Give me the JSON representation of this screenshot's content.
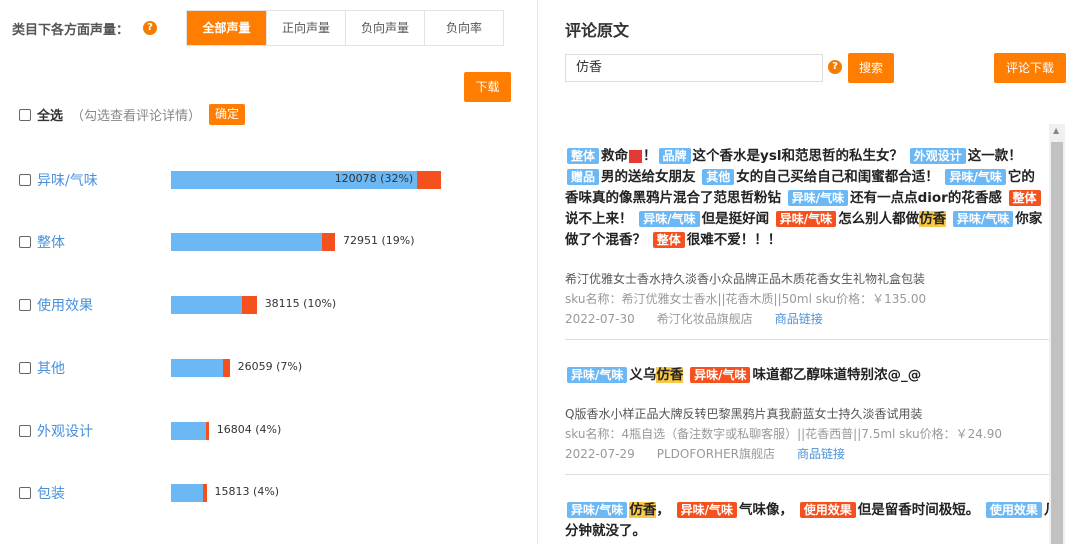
{
  "left": {
    "title": "类目下各方面声量：",
    "help_icon": "?",
    "tabs": [
      "全部声量",
      "正向声量",
      "负向声量",
      "负向率"
    ],
    "download": "下载",
    "select_all": "全选",
    "select_hint": "（勾选查看评论详情）",
    "confirm": "确定",
    "rows": [
      {
        "label": "异味/气味",
        "value_label": "120078 (32%)",
        "total": 120078,
        "negative_share": 0.09
      },
      {
        "label": "整体",
        "value_label": "72951 (19%)",
        "total": 72951,
        "negative_share": 0.08
      },
      {
        "label": "使用效果",
        "value_label": "38115 (10%)",
        "total": 38115,
        "negative_share": 0.17
      },
      {
        "label": "其他",
        "value_label": "26059 (7%)",
        "total": 26059,
        "negative_share": 0.12
      },
      {
        "label": "外观设计",
        "value_label": "16804 (4%)",
        "total": 16804,
        "negative_share": 0.05
      },
      {
        "label": "包装",
        "value_label": "15813 (4%)",
        "total": 15813,
        "negative_share": 0.09
      }
    ]
  },
  "right": {
    "title": "评论原文",
    "search_value": "仿香",
    "help_icon": "?",
    "search": "搜索",
    "download": "评论下载",
    "comments": [
      {
        "lines": [
          [
            [
              "t",
              "b",
              "整体"
            ],
            [
              "s",
              "救命"
            ],
            [
              "sos"
            ],
            [
              "s",
              "！"
            ],
            [
              "t",
              "b",
              "品牌"
            ],
            [
              "s",
              "这个香水是ysl和范思哲的私生女？ "
            ],
            [
              "t",
              "b",
              "外观设计"
            ],
            [
              "s",
              "这一款！"
            ]
          ],
          [
            [
              "t",
              "b",
              "赠品"
            ],
            [
              "s",
              "男的送给女朋友 "
            ],
            [
              "t",
              "b",
              "其他"
            ],
            [
              "s",
              "女的自己买给自己和闺蜜都合适！ "
            ],
            [
              "t",
              "b",
              "异味/气味"
            ],
            [
              "s",
              "它的"
            ]
          ],
          [
            [
              "s",
              "香味真的像黑鸦片混合了范思哲粉钻 "
            ],
            [
              "t",
              "b",
              "异味/气味"
            ],
            [
              "s",
              "还有一点点dior的花香感 "
            ],
            [
              "t",
              "r",
              "整体"
            ]
          ],
          [
            [
              "s",
              "说不上来！ "
            ],
            [
              "t",
              "b",
              "异味/气味"
            ],
            [
              "s",
              "但是挺好闻 "
            ],
            [
              "t",
              "r",
              "异味/气味"
            ],
            [
              "s",
              "怎么别人都做"
            ],
            [
              "h",
              "仿香"
            ],
            [
              "s",
              " "
            ],
            [
              "t",
              "b",
              "异味/气味"
            ],
            [
              "s",
              "你家"
            ]
          ],
          [
            [
              "s",
              "做了个混香？ "
            ],
            [
              "t",
              "r",
              "整体"
            ],
            [
              "s",
              "很难不爱！！！"
            ]
          ]
        ],
        "product": "希汀优雅女士香水持久淡香小众品牌正品木质花香女生礼物礼盒包装",
        "sku": "sku名称：希汀优雅女士香水||花香木质||50ml   sku价格：￥135.00",
        "date": "2022-07-30",
        "store": "希汀化妆品旗舰店",
        "link": "商品链接"
      },
      {
        "lines": [
          [
            [
              "t",
              "b",
              "异味/气味"
            ],
            [
              "s",
              "义乌"
            ],
            [
              "h",
              "仿香"
            ],
            [
              "s",
              " "
            ],
            [
              "t",
              "r",
              "异味/气味"
            ],
            [
              "s",
              "味道都乙醇味道特别浓@_@"
            ]
          ]
        ],
        "product": "Q版香水小样正品大牌反转巴黎黑鸦片真我蔚蓝女士持久淡香试用装",
        "sku": "sku名称：4瓶自选（备注数字或私聊客服）||花香西普||7.5ml   sku价格：￥24.90",
        "date": "2022-07-29",
        "store": "PLDOFORHER旗舰店",
        "link": "商品链接"
      },
      {
        "lines": [
          [
            [
              "t",
              "b",
              "异味/气味"
            ],
            [
              "h",
              "仿香"
            ],
            [
              "s",
              "， "
            ],
            [
              "t",
              "r",
              "异味/气味"
            ],
            [
              "s",
              "气味像， "
            ],
            [
              "t",
              "r",
              "使用效果"
            ],
            [
              "s",
              "但是留香时间极短。 "
            ],
            [
              "t",
              "b",
              "使用效果"
            ],
            [
              "s",
              "几"
            ]
          ],
          [
            [
              "s",
              "分钟就没了。"
            ]
          ]
        ]
      }
    ]
  }
}
